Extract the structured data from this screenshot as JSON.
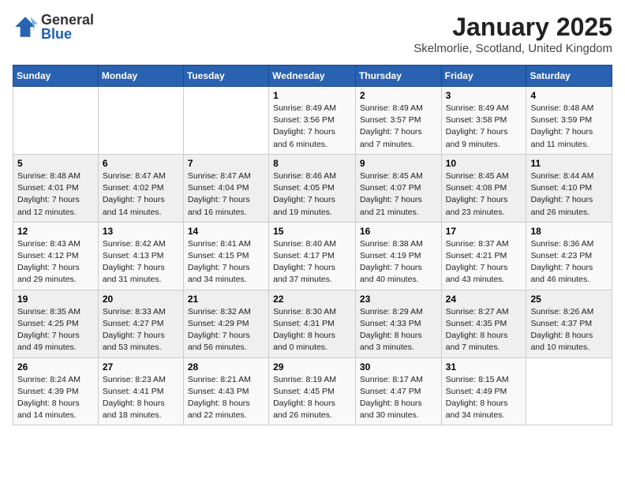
{
  "header": {
    "logo_general": "General",
    "logo_blue": "Blue",
    "month_title": "January 2025",
    "subtitle": "Skelmorlie, Scotland, United Kingdom"
  },
  "weekdays": [
    "Sunday",
    "Monday",
    "Tuesday",
    "Wednesday",
    "Thursday",
    "Friday",
    "Saturday"
  ],
  "weeks": [
    [
      {
        "day": "",
        "info": ""
      },
      {
        "day": "",
        "info": ""
      },
      {
        "day": "",
        "info": ""
      },
      {
        "day": "1",
        "info": "Sunrise: 8:49 AM\nSunset: 3:56 PM\nDaylight: 7 hours and 6 minutes."
      },
      {
        "day": "2",
        "info": "Sunrise: 8:49 AM\nSunset: 3:57 PM\nDaylight: 7 hours and 7 minutes."
      },
      {
        "day": "3",
        "info": "Sunrise: 8:49 AM\nSunset: 3:58 PM\nDaylight: 7 hours and 9 minutes."
      },
      {
        "day": "4",
        "info": "Sunrise: 8:48 AM\nSunset: 3:59 PM\nDaylight: 7 hours and 11 minutes."
      }
    ],
    [
      {
        "day": "5",
        "info": "Sunrise: 8:48 AM\nSunset: 4:01 PM\nDaylight: 7 hours and 12 minutes."
      },
      {
        "day": "6",
        "info": "Sunrise: 8:47 AM\nSunset: 4:02 PM\nDaylight: 7 hours and 14 minutes."
      },
      {
        "day": "7",
        "info": "Sunrise: 8:47 AM\nSunset: 4:04 PM\nDaylight: 7 hours and 16 minutes."
      },
      {
        "day": "8",
        "info": "Sunrise: 8:46 AM\nSunset: 4:05 PM\nDaylight: 7 hours and 19 minutes."
      },
      {
        "day": "9",
        "info": "Sunrise: 8:45 AM\nSunset: 4:07 PM\nDaylight: 7 hours and 21 minutes."
      },
      {
        "day": "10",
        "info": "Sunrise: 8:45 AM\nSunset: 4:08 PM\nDaylight: 7 hours and 23 minutes."
      },
      {
        "day": "11",
        "info": "Sunrise: 8:44 AM\nSunset: 4:10 PM\nDaylight: 7 hours and 26 minutes."
      }
    ],
    [
      {
        "day": "12",
        "info": "Sunrise: 8:43 AM\nSunset: 4:12 PM\nDaylight: 7 hours and 29 minutes."
      },
      {
        "day": "13",
        "info": "Sunrise: 8:42 AM\nSunset: 4:13 PM\nDaylight: 7 hours and 31 minutes."
      },
      {
        "day": "14",
        "info": "Sunrise: 8:41 AM\nSunset: 4:15 PM\nDaylight: 7 hours and 34 minutes."
      },
      {
        "day": "15",
        "info": "Sunrise: 8:40 AM\nSunset: 4:17 PM\nDaylight: 7 hours and 37 minutes."
      },
      {
        "day": "16",
        "info": "Sunrise: 8:38 AM\nSunset: 4:19 PM\nDaylight: 7 hours and 40 minutes."
      },
      {
        "day": "17",
        "info": "Sunrise: 8:37 AM\nSunset: 4:21 PM\nDaylight: 7 hours and 43 minutes."
      },
      {
        "day": "18",
        "info": "Sunrise: 8:36 AM\nSunset: 4:23 PM\nDaylight: 7 hours and 46 minutes."
      }
    ],
    [
      {
        "day": "19",
        "info": "Sunrise: 8:35 AM\nSunset: 4:25 PM\nDaylight: 7 hours and 49 minutes."
      },
      {
        "day": "20",
        "info": "Sunrise: 8:33 AM\nSunset: 4:27 PM\nDaylight: 7 hours and 53 minutes."
      },
      {
        "day": "21",
        "info": "Sunrise: 8:32 AM\nSunset: 4:29 PM\nDaylight: 7 hours and 56 minutes."
      },
      {
        "day": "22",
        "info": "Sunrise: 8:30 AM\nSunset: 4:31 PM\nDaylight: 8 hours and 0 minutes."
      },
      {
        "day": "23",
        "info": "Sunrise: 8:29 AM\nSunset: 4:33 PM\nDaylight: 8 hours and 3 minutes."
      },
      {
        "day": "24",
        "info": "Sunrise: 8:27 AM\nSunset: 4:35 PM\nDaylight: 8 hours and 7 minutes."
      },
      {
        "day": "25",
        "info": "Sunrise: 8:26 AM\nSunset: 4:37 PM\nDaylight: 8 hours and 10 minutes."
      }
    ],
    [
      {
        "day": "26",
        "info": "Sunrise: 8:24 AM\nSunset: 4:39 PM\nDaylight: 8 hours and 14 minutes."
      },
      {
        "day": "27",
        "info": "Sunrise: 8:23 AM\nSunset: 4:41 PM\nDaylight: 8 hours and 18 minutes."
      },
      {
        "day": "28",
        "info": "Sunrise: 8:21 AM\nSunset: 4:43 PM\nDaylight: 8 hours and 22 minutes."
      },
      {
        "day": "29",
        "info": "Sunrise: 8:19 AM\nSunset: 4:45 PM\nDaylight: 8 hours and 26 minutes."
      },
      {
        "day": "30",
        "info": "Sunrise: 8:17 AM\nSunset: 4:47 PM\nDaylight: 8 hours and 30 minutes."
      },
      {
        "day": "31",
        "info": "Sunrise: 8:15 AM\nSunset: 4:49 PM\nDaylight: 8 hours and 34 minutes."
      },
      {
        "day": "",
        "info": ""
      }
    ]
  ]
}
